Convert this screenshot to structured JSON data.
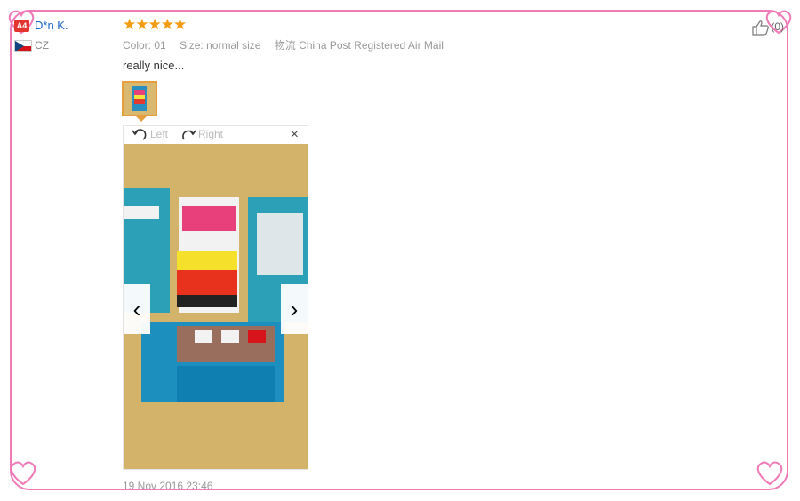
{
  "reviewer": {
    "badge": "A4",
    "name": "D*n K.",
    "country": "CZ"
  },
  "rating": {
    "stars": "★★★★★",
    "value": 5
  },
  "attributes": [
    {
      "label": "Color:",
      "value": "01"
    },
    {
      "label": "Size:",
      "value": "normal size"
    },
    {
      "label": "物流",
      "value": "China Post Registered Air Mail"
    }
  ],
  "comment": "really nice...",
  "viewer": {
    "rotate_left": "Left",
    "rotate_right": "Right",
    "close": "×",
    "prev": "‹",
    "next": "›"
  },
  "like": {
    "count": "(0)"
  },
  "date": "19 Nov 2016 23:46",
  "colors": {
    "frame": "#f07ab8",
    "name": "#1d64c8",
    "stars": "#f39c12",
    "thumb_border": "#e69f3f"
  },
  "icons": [
    "heart-icon",
    "thumbs-up-icon",
    "rotate-left-icon",
    "rotate-right-icon",
    "close-icon",
    "chevron-left-icon",
    "chevron-right-icon"
  ]
}
